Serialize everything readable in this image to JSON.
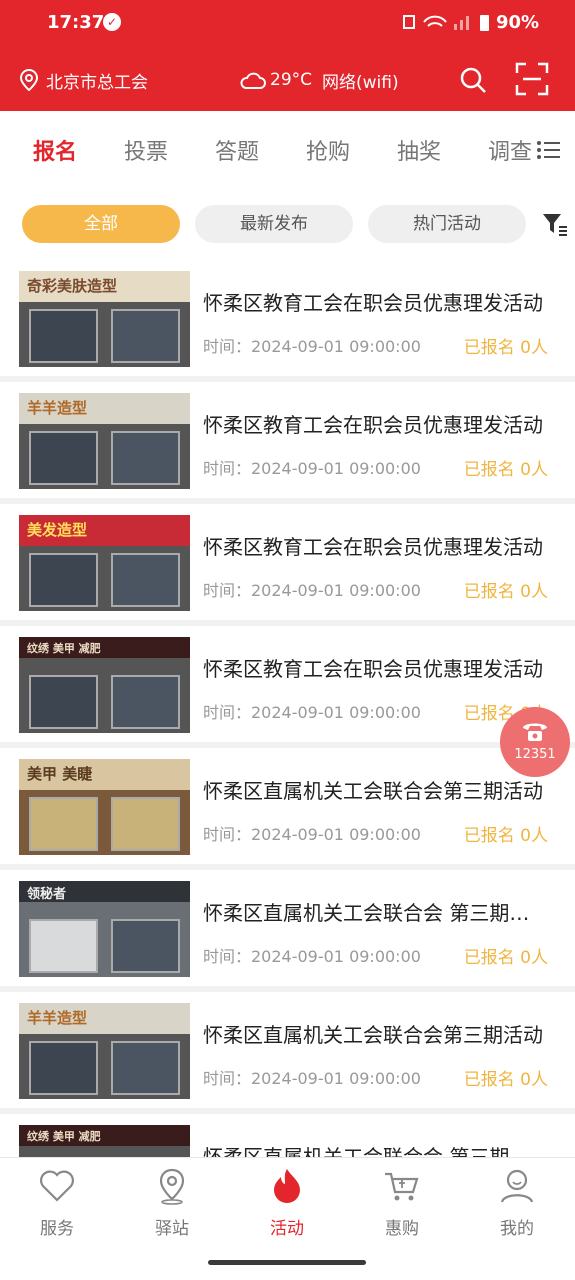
{
  "status_bar": {
    "time": "17:37",
    "battery": "90%"
  },
  "header": {
    "location": "北京市总工会",
    "temperature": "29°C",
    "network": "网络(wifi)"
  },
  "tabs": [
    "报名",
    "投票",
    "答题",
    "抢购",
    "抽奖",
    "调查"
  ],
  "filters": [
    "全部",
    "最新发布",
    "热门活动"
  ],
  "items": [
    {
      "title": "怀柔区教育工会在职会员优惠理发活动",
      "time": "时间：2024-09-01 09:00:00",
      "count": "已报名 0人",
      "sign": "奇彩美肤造型"
    },
    {
      "title": "怀柔区教育工会在职会员优惠理发活动",
      "time": "时间：2024-09-01 09:00:00",
      "count": "已报名 0人",
      "sign": "羊羊造型"
    },
    {
      "title": "怀柔区教育工会在职会员优惠理发活动",
      "time": "时间：2024-09-01 09:00:00",
      "count": "已报名 0人",
      "sign": "美发造型"
    },
    {
      "title": "怀柔区教育工会在职会员优惠理发活动",
      "time": "时间：2024-09-01 09:00:00",
      "count": "已报名 0人",
      "sign": "纹绣 美甲 减肥"
    },
    {
      "title": "怀柔区直属机关工会联合会第三期活动",
      "time": "时间：2024-09-01 09:00:00",
      "count": "已报名 0人",
      "sign": "美甲 美睫"
    },
    {
      "title": "怀柔区直属机关工会联合会 第三期活动",
      "time": "时间：2024-09-01 09:00:00",
      "count": "已报名 0人",
      "sign": "领秘者"
    },
    {
      "title": "怀柔区直属机关工会联合会第三期活动",
      "time": "时间：2024-09-01 09:00:00",
      "count": "已报名 0人",
      "sign": "羊羊造型"
    },
    {
      "title": "怀柔区直属机关工会联合会 第三期活动",
      "time": "",
      "count": "",
      "sign": "纹绣 美甲 减肥"
    }
  ],
  "phone_fab": {
    "number": "12351"
  },
  "bottom_nav": [
    "服务",
    "驿站",
    "活动",
    "惠购",
    "我的"
  ],
  "colors": {
    "brand": "#e3262b",
    "accent": "#f7b84b"
  }
}
